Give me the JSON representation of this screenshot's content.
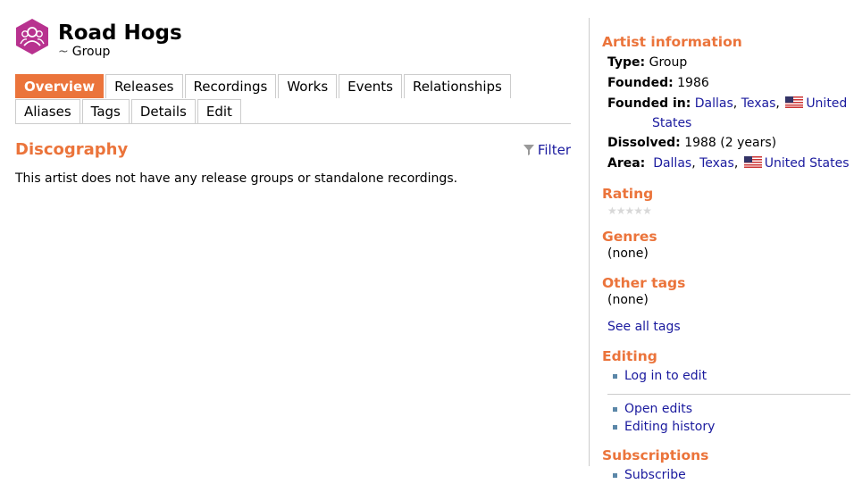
{
  "artist": {
    "name": "Road Hogs",
    "type_tilde": "~",
    "type": "Group"
  },
  "tabs_row1": [
    "Overview",
    "Releases",
    "Recordings",
    "Works",
    "Events",
    "Relationships"
  ],
  "tabs_row2": [
    "Aliases",
    "Tags",
    "Details",
    "Edit"
  ],
  "discography": {
    "heading": "Discography",
    "filter_label": "Filter",
    "empty_message": "This artist does not have any release groups or standalone recordings."
  },
  "sidebar": {
    "artist_info_heading": "Artist information",
    "type_label": "Type:",
    "type_value": "Group",
    "founded_label": "Founded:",
    "founded_value": "1986",
    "founded_in_label": "Founded in:",
    "founded_in_city": "Dallas",
    "founded_in_state": "Texas",
    "founded_in_country_1": "United",
    "founded_in_country_2": "States",
    "dissolved_label": "Dissolved:",
    "dissolved_value": "1988 (2 years)",
    "area_label": "Area:",
    "area_city": "Dallas",
    "area_state": "Texas",
    "area_country": "United States",
    "rating_heading": "Rating",
    "rating_value": 0,
    "genres_heading": "Genres",
    "genres_value": "(none)",
    "other_tags_heading": "Other tags",
    "other_tags_value": "(none)",
    "see_all_tags": "See all tags",
    "editing_heading": "Editing",
    "log_in_to_edit": "Log in to edit",
    "open_edits": "Open edits",
    "editing_history": "Editing history",
    "subscriptions_heading": "Subscriptions",
    "subscribe": "Subscribe"
  },
  "colors": {
    "accent": "#eb743b",
    "logo": "#b8328f",
    "link": "#1a1a9e"
  }
}
